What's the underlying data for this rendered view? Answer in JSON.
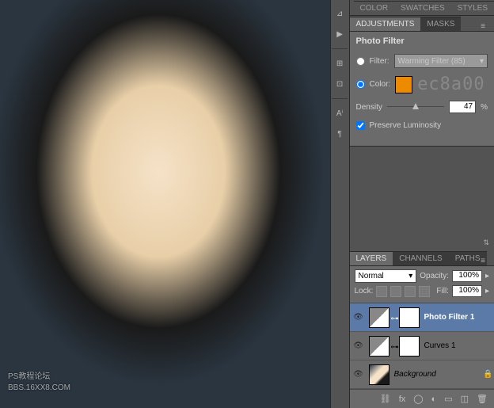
{
  "watermark": {
    "line1": "PS教程论坛",
    "line2": "BBS.16XX8.COM"
  },
  "toolbar": [
    "⊿",
    "▶",
    "⊞",
    "⊡",
    "Aⁱ",
    "¶"
  ],
  "top_tabs": {
    "color": "COLOR",
    "swatches": "SWATCHES",
    "styles": "STYLES"
  },
  "adjustments": {
    "tab_adjustments": "ADJUSTMENTS",
    "tab_masks": "MASKS",
    "panel_title": "Photo Filter",
    "filter_label": "Filter:",
    "filter_value": "Warming Filter (85)",
    "color_label": "Color:",
    "color_hex": "ec8a00",
    "density_label": "Density",
    "density_value": "47",
    "density_unit": "%",
    "preserve_label": "Preserve Luminosity",
    "preserve_checked": true,
    "filter_selected": false,
    "color_selected": true
  },
  "layers": {
    "tab_layers": "LAYERS",
    "tab_channels": "CHANNELS",
    "tab_paths": "PATHS",
    "blend_mode": "Normal",
    "opacity_label": "Opacity:",
    "opacity_value": "100%",
    "lock_label": "Lock:",
    "fill_label": "Fill:",
    "fill_value": "100%",
    "items": [
      {
        "name": "Photo Filter 1",
        "selected": true,
        "visible": true,
        "type": "adjustment"
      },
      {
        "name": "Curves 1",
        "selected": false,
        "visible": true,
        "type": "adjustment"
      },
      {
        "name": "Background",
        "selected": false,
        "visible": true,
        "type": "background",
        "locked": true
      }
    ]
  }
}
